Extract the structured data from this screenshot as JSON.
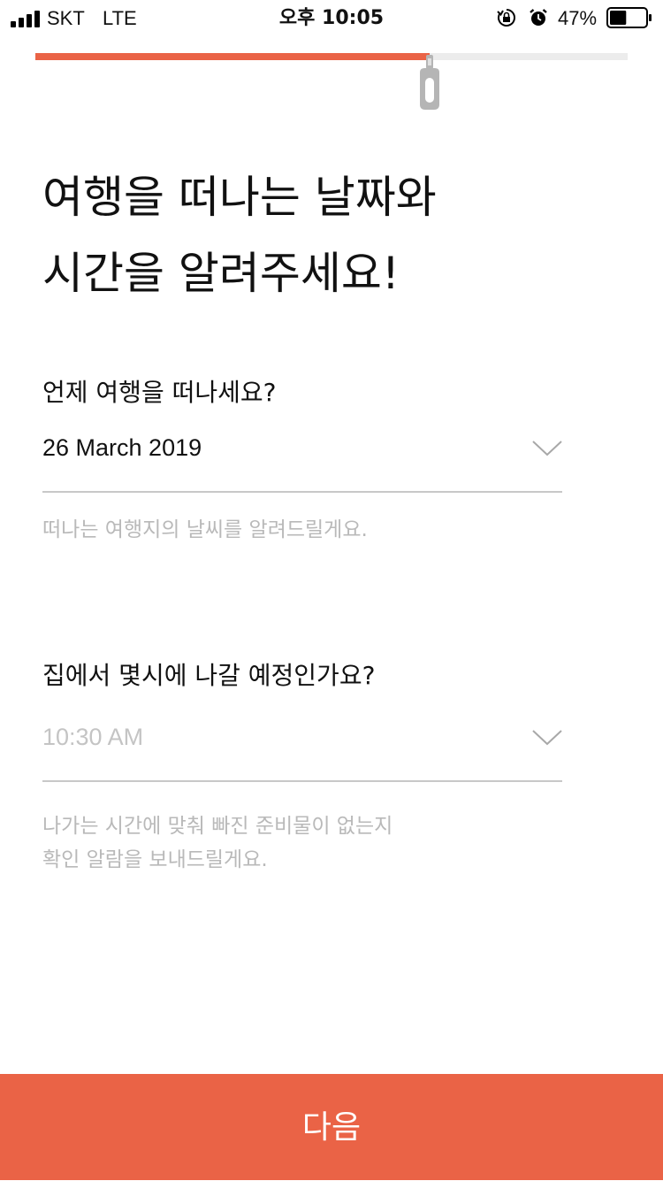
{
  "status_bar": {
    "carrier": "SKT",
    "network": "LTE",
    "time": "오후 10:05",
    "battery_percent_label": "47%",
    "battery_level": 0.47,
    "signal_bars": 4,
    "icons": [
      "signal-icon",
      "rotation-lock-icon",
      "alarm-icon",
      "battery-icon"
    ]
  },
  "progress": {
    "value": 0.665,
    "fill_color": "#ea6346",
    "track_color": "#ececec",
    "handle_icon": "zipper-icon"
  },
  "headline": {
    "line1": "여행을 떠나는 날짜와",
    "line2": "시간을 알려주세요!"
  },
  "date_field": {
    "label": "언제 여행을 떠나세요?",
    "value": "26 March 2019",
    "value_is_placeholder": false,
    "icon": "chevron-down-icon",
    "helper": "떠나는 여행지의 날씨를 알려드릴게요."
  },
  "time_field": {
    "label": "집에서 몇시에 나갈 예정인가요?",
    "value": "10:30 AM",
    "value_is_placeholder": true,
    "icon": "chevron-down-icon",
    "helper_lines": [
      "나가는 시간에 맞춰 빠진 준비물이 없는지",
      "확인 알람을 보내드릴게요."
    ]
  },
  "next_button": {
    "label": "다음",
    "color": "#ea6346"
  },
  "colors": {
    "accent": "#ea6346",
    "placeholder": "#b9b9b9",
    "divider": "#c8c8c8"
  }
}
